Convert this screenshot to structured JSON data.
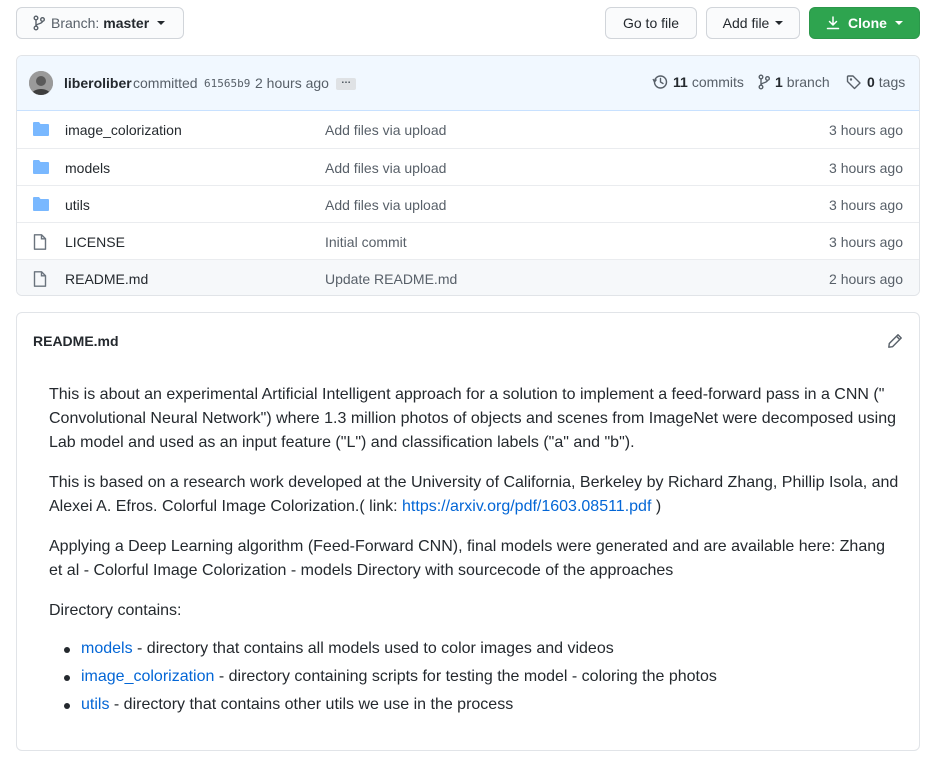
{
  "toolbar": {
    "branch_prefix": "Branch:",
    "branch_name": "master",
    "goto_file": "Go to file",
    "add_file": "Add file",
    "clone": "Clone"
  },
  "commit": {
    "user": "liberoliber",
    "word": "committed",
    "sha": "61565b9",
    "time": "2 hours ago",
    "ellipsis": "…",
    "commits_count": "11",
    "commits_label": "commits",
    "branch_count": "1",
    "branch_label": "branch",
    "tags_count": "0",
    "tags_label": "tags"
  },
  "files": [
    {
      "name": "image_colorization",
      "type": "folder",
      "message": "Add files via upload",
      "age": "3 hours ago"
    },
    {
      "name": "models",
      "type": "folder",
      "message": "Add files via upload",
      "age": "3 hours ago"
    },
    {
      "name": "utils",
      "type": "folder",
      "message": "Add files via upload",
      "age": "3 hours ago"
    },
    {
      "name": "LICENSE",
      "type": "file",
      "message": "Initial commit",
      "age": "3 hours ago"
    },
    {
      "name": "README.md",
      "type": "file",
      "message": "Update README.md",
      "age": "2 hours ago"
    }
  ],
  "readme": {
    "title": "README.md",
    "p1": "This is about an experimental Artificial Intelligent approach for a solution to implement a feed-forward pass in a CNN (\" Convolutional Neural Network\") where 1.3 million photos of objects and scenes from ImageNet were decomposed using Lab model and used as an input feature (\"L\") and classification labels (\"a\" and \"b\").",
    "p2_before": "This is based on a research work developed at the University of California, Berkeley by Richard Zhang, Phillip Isola, and Alexei A. Efros. Colorful Image Colorization.( link: ",
    "p2_link": "https://arxiv.org/pdf/1603.08511.pdf",
    "p2_after": " )",
    "p3": "Applying a Deep Learning algorithm (Feed-Forward CNN), final models were generated and are available here: Zhang et al - Colorful Image Colorization - models Directory with sourcecode of the approaches",
    "p4": "Directory contains:",
    "list": [
      {
        "link": "models",
        "text": " - directory that contains all models used to color images and videos"
      },
      {
        "link": "image_colorization",
        "text": " - directory containing scripts for testing the model - coloring the photos"
      },
      {
        "link": "utils",
        "text": " - directory that contains other utils we use in the process"
      }
    ]
  },
  "colors": {
    "accent_green": "#2ea44f",
    "link_blue": "#0366d6",
    "folder_icon": "#79b8ff",
    "commit_bar_bg": "#f1f8ff"
  },
  "icons": {
    "branch": "git-branch-icon",
    "caret": "triangle-down-icon",
    "clone": "download-icon",
    "history": "history-icon",
    "tag": "tag-icon",
    "folder": "folder-icon",
    "file": "file-icon",
    "edit": "pencil-icon"
  }
}
